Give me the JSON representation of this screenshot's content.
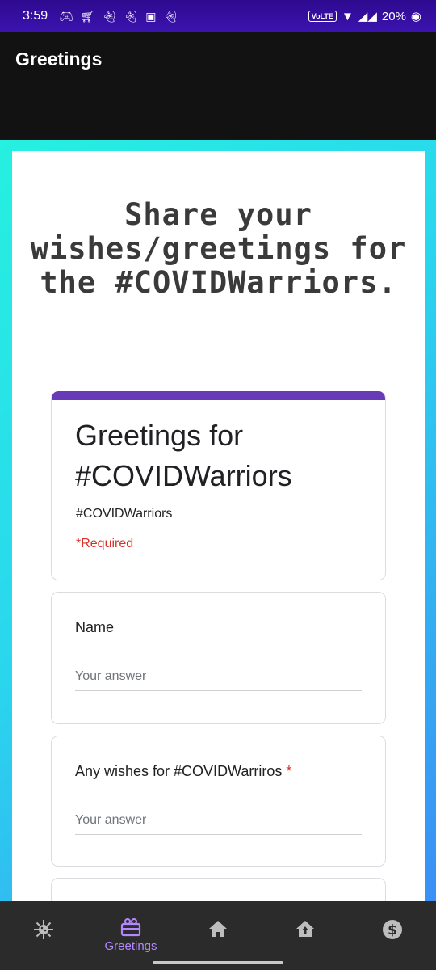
{
  "status_bar": {
    "time": "3:59",
    "volte": "VoLTE",
    "battery": "20%",
    "notification_icons": [
      "gamepad-icon",
      "cart-icon",
      "snapchat-icon",
      "snapchat-icon",
      "instagram-icon",
      "snapchat-icon"
    ]
  },
  "app_bar": {
    "title": "Greetings"
  },
  "headline": "Share your wishes/greetings for the #COVIDWarriors.",
  "form": {
    "title": "Greetings for #COVIDWarriors",
    "description": "#COVIDWarriors",
    "required_note": "*Required",
    "accent_color": "#673ab7",
    "questions": [
      {
        "label": "Name",
        "required": false,
        "placeholder": "Your answer"
      },
      {
        "label": "Any wishes for #COVIDWarriros",
        "required": true,
        "required_mark": "*",
        "placeholder": "Your answer"
      }
    ]
  },
  "bottom_nav": {
    "items": [
      {
        "icon": "virus-icon",
        "label": ""
      },
      {
        "icon": "gift-icon",
        "label": "Greetings",
        "active": true
      },
      {
        "icon": "home-icon",
        "label": ""
      },
      {
        "icon": "house-upload-icon",
        "label": ""
      },
      {
        "icon": "dollar-icon",
        "label": ""
      }
    ],
    "active_color": "#b388ff"
  }
}
